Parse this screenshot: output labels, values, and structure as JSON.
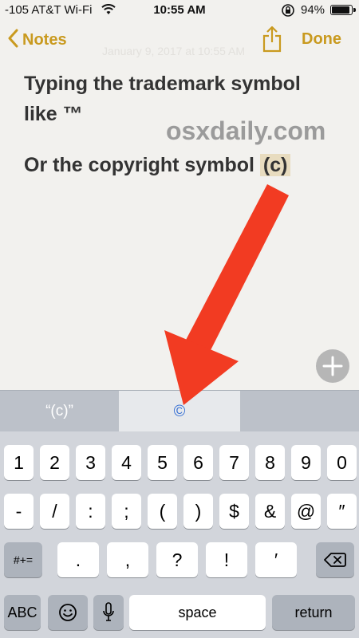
{
  "status": {
    "carrier": "-105 AT&T Wi-Fi",
    "time": "10:55 AM",
    "battery": "94%",
    "battery_level": 0.94
  },
  "nav": {
    "back_label": "Notes",
    "done_label": "Done",
    "faded_text": "January 9, 2017 at 10:55 AM"
  },
  "note": {
    "line1": "Typing the trademark symbol",
    "line2": "like ™",
    "line3_prefix": "Or the copyright symbol",
    "line3_highlight": "(c)"
  },
  "watermark": "osxdaily.com",
  "suggestions": [
    "“(c)”",
    "©",
    ""
  ],
  "keyboard": {
    "row1": [
      "1",
      "2",
      "3",
      "4",
      "5",
      "6",
      "7",
      "8",
      "9",
      "0"
    ],
    "row2": [
      "-",
      "/",
      ":",
      ";",
      "(",
      ")",
      "$",
      "&",
      "@",
      "″"
    ],
    "row3_left": "#+=",
    "row3": [
      ".",
      ",",
      "?",
      "!",
      "′"
    ],
    "row4_abc": "ABC",
    "row4_space": "space",
    "row4_return": "return"
  },
  "colors": {
    "accent": "#c99a1f",
    "arrow": "#f23b22",
    "suggestion_selected": "#3a72d4"
  },
  "icons": {
    "wifi": "wifi-icon",
    "rotation_lock": "rotation-lock-icon",
    "share": "share-icon",
    "plus": "plus-icon",
    "emoji": "emoji-icon",
    "mic": "microphone-icon",
    "backspace": "backspace-icon"
  }
}
